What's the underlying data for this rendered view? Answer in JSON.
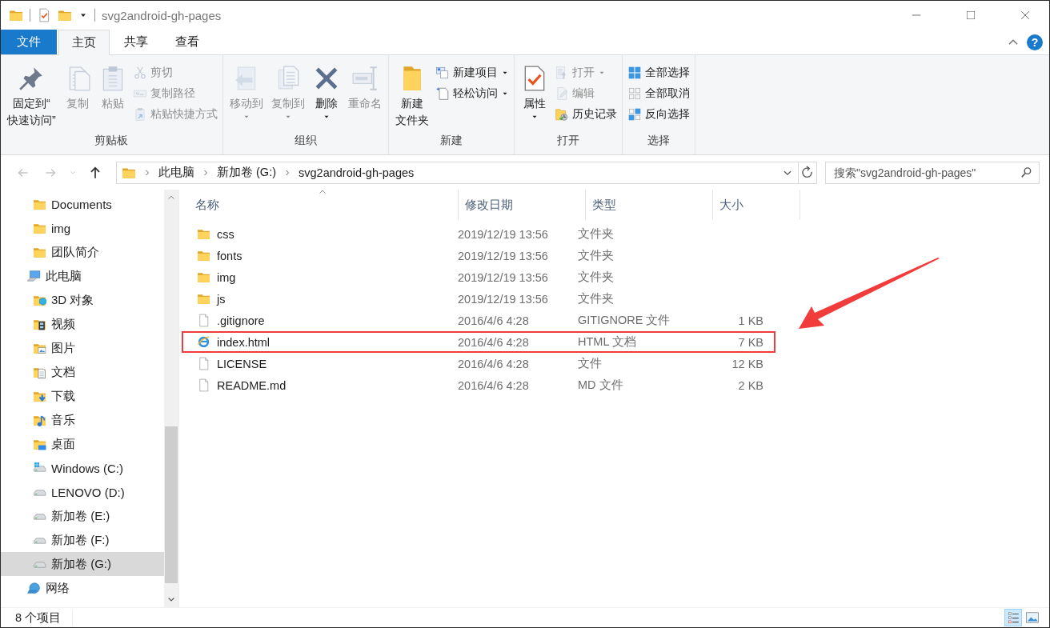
{
  "title_bar": {
    "title": "svg2android-gh-pages"
  },
  "ribbon_tabs": [
    {
      "label": "文件",
      "kind": "file",
      "selected": false
    },
    {
      "label": "主页",
      "kind": "tab",
      "selected": true
    },
    {
      "label": "共享",
      "kind": "tab",
      "selected": false
    },
    {
      "label": "查看",
      "kind": "tab",
      "selected": false
    }
  ],
  "help_button": {
    "label": "?"
  },
  "ribbon_groups": [
    {
      "label": "剪贴板",
      "items": [
        {
          "kind": "pin",
          "label_lines": [
            "固定到“",
            "快速访问”"
          ],
          "disabled": false,
          "dropdown": false
        },
        {
          "kind": "copy",
          "label_lines": [
            "复制"
          ],
          "disabled": true,
          "dropdown": false
        },
        {
          "kind": "paste",
          "label_lines": [
            "粘贴"
          ],
          "disabled": true,
          "dropdown": false
        },
        {
          "kind": "stack",
          "buttons": [
            {
              "kind": "cut",
              "label": "剪切",
              "disabled": true,
              "dropdown": false
            },
            {
              "kind": "copy_path",
              "label": "复制路径",
              "disabled": true,
              "dropdown": false
            },
            {
              "kind": "shortcut",
              "label": "粘贴快捷方式",
              "disabled": true,
              "dropdown": false
            }
          ]
        }
      ]
    },
    {
      "label": "组织",
      "items": [
        {
          "kind": "move",
          "label_lines": [
            "移动到"
          ],
          "disabled": true,
          "dropdown": true
        },
        {
          "kind": "copy_to",
          "label_lines": [
            "复制到"
          ],
          "disabled": true,
          "dropdown": true
        },
        {
          "kind": "delete",
          "label_lines": [
            "删除"
          ],
          "disabled": false,
          "dropdown": true
        },
        {
          "kind": "rename",
          "label_lines": [
            "重命名"
          ],
          "disabled": true,
          "dropdown": false
        }
      ]
    },
    {
      "label": "新建",
      "items": [
        {
          "kind": "new_folder",
          "label_lines": [
            "新建",
            "文件夹"
          ],
          "disabled": false,
          "dropdown": false
        },
        {
          "kind": "stack",
          "buttons": [
            {
              "kind": "new_item",
              "label": "新建项目",
              "disabled": false,
              "dropdown": true
            },
            {
              "kind": "easy_access",
              "label": "轻松访问",
              "disabled": false,
              "dropdown": true
            }
          ]
        }
      ]
    },
    {
      "label": "打开",
      "items": [
        {
          "kind": "properties",
          "label_lines": [
            "属性"
          ],
          "disabled": false,
          "dropdown": true
        },
        {
          "kind": "stack",
          "buttons": [
            {
              "kind": "open",
              "label": "打开",
              "disabled": true,
              "dropdown": true
            },
            {
              "kind": "edit",
              "label": "编辑",
              "disabled": true,
              "dropdown": false
            },
            {
              "kind": "history",
              "label": "历史记录",
              "disabled": false,
              "dropdown": false
            }
          ]
        }
      ]
    },
    {
      "label": "选择",
      "items": [
        {
          "kind": "stack",
          "buttons": [
            {
              "kind": "select_all",
              "label": "全部选择",
              "disabled": false,
              "dropdown": false
            },
            {
              "kind": "select_none",
              "label": "全部取消",
              "disabled": false,
              "dropdown": false
            },
            {
              "kind": "invert",
              "label": "反向选择",
              "disabled": false,
              "dropdown": false
            }
          ]
        }
      ]
    }
  ],
  "address_bar": {
    "nav_buttons": [
      {
        "kind": "back",
        "disabled": true
      },
      {
        "kind": "forward",
        "disabled": true
      },
      {
        "kind": "recent",
        "disabled": true
      },
      {
        "kind": "up",
        "disabled": false
      }
    ],
    "crumbs": [
      "此电脑",
      "新加卷 (G:)",
      "svg2android-gh-pages"
    ]
  },
  "search": {
    "placeholder": "搜索\"svg2android-gh-pages\""
  },
  "sidebar": {
    "quick_access_items": [
      {
        "label": "Documents",
        "kind": "folder",
        "selected": false
      },
      {
        "label": "img",
        "kind": "folder",
        "selected": false
      },
      {
        "label": "团队简介",
        "kind": "folder",
        "selected": false
      }
    ],
    "tree": [
      {
        "label": "此电脑",
        "kind": "pc",
        "selected": false,
        "children": [
          {
            "label": "3D 对象",
            "kind": "cube3d",
            "selected": false
          },
          {
            "label": "视频",
            "kind": "video",
            "selected": false
          },
          {
            "label": "图片",
            "kind": "pictures",
            "selected": false
          },
          {
            "label": "文档",
            "kind": "documents",
            "selected": false
          },
          {
            "label": "下载",
            "kind": "downloads",
            "selected": false
          },
          {
            "label": "音乐",
            "kind": "music",
            "selected": false
          },
          {
            "label": "桌面",
            "kind": "desktop",
            "selected": false
          },
          {
            "label": "Windows (C:)",
            "kind": "windows_drive",
            "selected": false
          },
          {
            "label": "LENOVO (D:)",
            "kind": "drive",
            "selected": false
          },
          {
            "label": "新加卷 (E:)",
            "kind": "drive",
            "selected": false
          },
          {
            "label": "新加卷 (F:)",
            "kind": "drive",
            "selected": false
          },
          {
            "label": "新加卷 (G:)",
            "kind": "drive",
            "selected": true
          }
        ]
      },
      {
        "label": "网络",
        "kind": "network",
        "selected": false
      }
    ]
  },
  "file_list": {
    "columns": [
      {
        "label": "名称",
        "sorted": true
      },
      {
        "label": "修改日期",
        "sorted": false
      },
      {
        "label": "类型",
        "sorted": false
      },
      {
        "label": "大小",
        "sorted": false
      }
    ],
    "rows": [
      {
        "kind": "folder",
        "name": "css",
        "modified": "2019/12/19 13:56",
        "type": "文件夹",
        "annotated": false
      },
      {
        "kind": "folder",
        "name": "fonts",
        "modified": "2019/12/19 13:56",
        "type": "文件夹",
        "annotated": false
      },
      {
        "kind": "folder",
        "name": "img",
        "modified": "2019/12/19 13:56",
        "type": "文件夹",
        "annotated": false
      },
      {
        "kind": "folder",
        "name": "js",
        "modified": "2019/12/19 13:56",
        "type": "文件夹",
        "annotated": false
      },
      {
        "kind": "file",
        "name": ".gitignore",
        "modified": "2016/4/6 4:28",
        "type": "GITIGNORE 文件",
        "size": "1 KB",
        "annotated": false
      },
      {
        "kind": "html",
        "name": "index.html",
        "modified": "2016/4/6 4:28",
        "type": "HTML 文档",
        "size": "7 KB",
        "annotated": true
      },
      {
        "kind": "file",
        "name": "LICENSE",
        "modified": "2016/4/6 4:28",
        "type": "文件",
        "size": "12 KB",
        "annotated": false
      },
      {
        "kind": "file",
        "name": "README.md",
        "modified": "2016/4/6 4:28",
        "type": "MD 文件",
        "size": "2 KB",
        "annotated": false
      }
    ]
  },
  "status_bar": {
    "item_count": "8 个项目",
    "views": [
      {
        "kind": "details",
        "selected": true
      },
      {
        "kind": "thumbnails",
        "selected": false
      }
    ]
  }
}
